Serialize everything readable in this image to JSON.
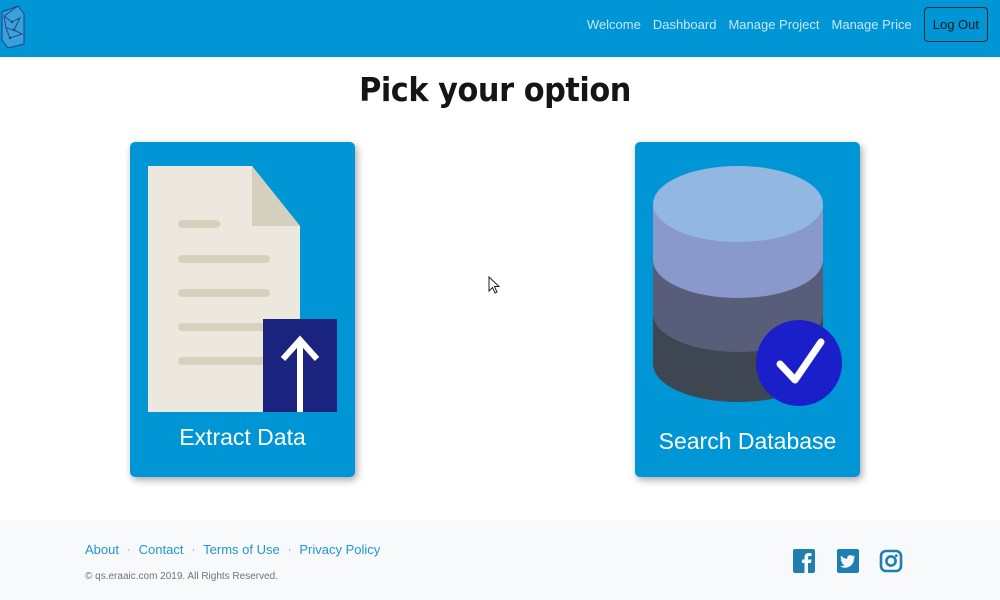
{
  "navbar": {
    "links": [
      "Welcome",
      "Dashboard",
      "Manage Project",
      "Manage Price"
    ],
    "logout_label": "Log Out"
  },
  "main": {
    "title": "Pick your option",
    "cards": [
      {
        "label": "Extract Data",
        "icon": "document-upload-icon"
      },
      {
        "label": "Search Database",
        "icon": "database-check-icon"
      }
    ]
  },
  "footer": {
    "links": [
      "About",
      "Contact",
      "Terms of Use",
      "Privacy Policy"
    ],
    "separator": "·",
    "copyright": "© qs.eraaic.com 2019. All Rights Reserved.",
    "social": [
      "facebook-icon",
      "twitter-icon",
      "instagram-icon"
    ]
  },
  "colors": {
    "primary": "#0096d6",
    "upload_box": "#1a237e",
    "check_circle": "#1a1fc9",
    "footer_link": "#2196d6"
  }
}
